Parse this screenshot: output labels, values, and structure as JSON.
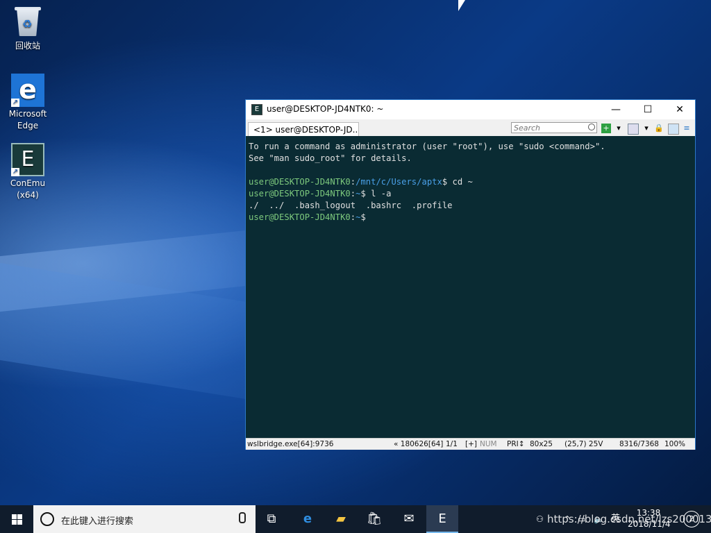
{
  "desktop": {
    "icons": [
      {
        "label": "回收站"
      },
      {
        "label": "Microsoft Edge"
      },
      {
        "label": "ConEmu (x64)"
      }
    ]
  },
  "window": {
    "title": "user@DESKTOP-JD4NTK0: ~",
    "controls": {
      "minimize": "—",
      "maximize": "☐",
      "close": "✕"
    },
    "tab_label": "<1> user@DESKTOP-JD...",
    "search_placeholder": "Search",
    "terminal": {
      "line1": "To run a command as administrator (user \"root\"), use \"sudo <command>\".",
      "line2": "See \"man sudo_root\" for details.",
      "line4_user": "user@DESKTOP-JD4NTK0",
      "line4_colon": ":",
      "line4_path": "/mnt/c/Users/aptx",
      "line4_cmd": "$ cd ~",
      "line5_user": "user@DESKTOP-JD4NTK0",
      "line5_colon": ":",
      "line5_path": "~",
      "line5_cmd": "$ l -a",
      "line6": "./  ../  .bash_logout  .bashrc  .profile",
      "line7_user": "user@DESKTOP-JD4NTK0",
      "line7_colon": ":",
      "line7_path": "~",
      "line7_cmd": "$"
    },
    "status": {
      "process": "wslbridge.exe[64]:9736",
      "pid": "« 180626[64]",
      "page": "1/1",
      "plus": "[+]",
      "num": "NUM",
      "pri": "PRI↕",
      "size": "80x25",
      "cursor": "(25,7) 25V",
      "buffer": "8316/7368",
      "zoom": "100%"
    }
  },
  "taskbar": {
    "search_placeholder": "在此键入进行搜索",
    "ime": "英",
    "time": "13:38",
    "date": "2018/11/4",
    "notifications": "2",
    "watermark": "https://blog.csdn.net/lzs2000131"
  }
}
